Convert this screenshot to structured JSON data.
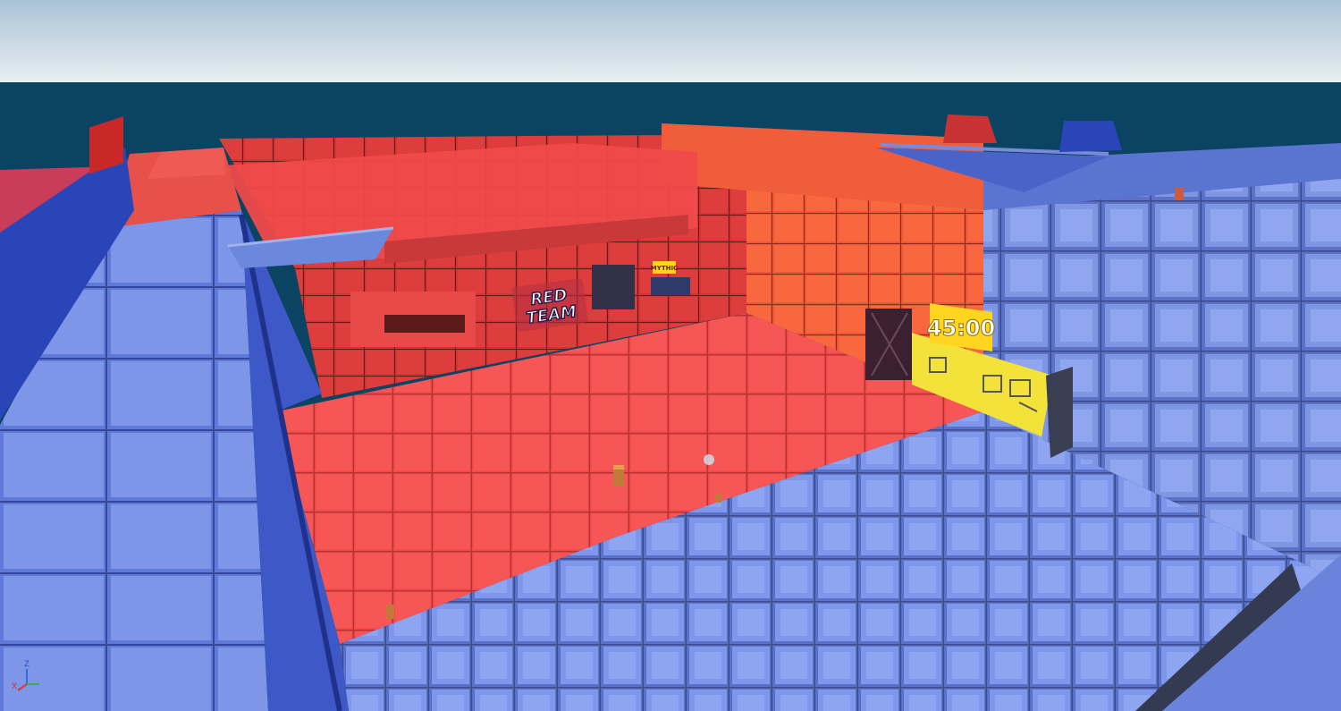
{
  "scene": {
    "colors": {
      "sky_top": "#a9c3d6",
      "sky_bottom": "#e6edf0",
      "sea": "#0b4463",
      "red_floor": "#f24a4a",
      "red_floor_grid": "#c23a3a",
      "red_wall": "#d83434",
      "orange_wall": "#f2623a",
      "blue_floor": "#6d86e4",
      "blue_floor_grid": "#4a5fa8",
      "blue_wall": "#6e89d8",
      "blue_rail": "#2a45b8",
      "timer_bg": "#ffd51f",
      "timer_text": "#ffffff"
    },
    "team_sign": {
      "line1": "RED",
      "line2": "TEAM"
    },
    "timer": {
      "value": "45:00"
    },
    "wall_sign": {
      "text": "MYTHIC"
    },
    "gizmo": {
      "labels": [
        "Z",
        "X"
      ]
    }
  }
}
